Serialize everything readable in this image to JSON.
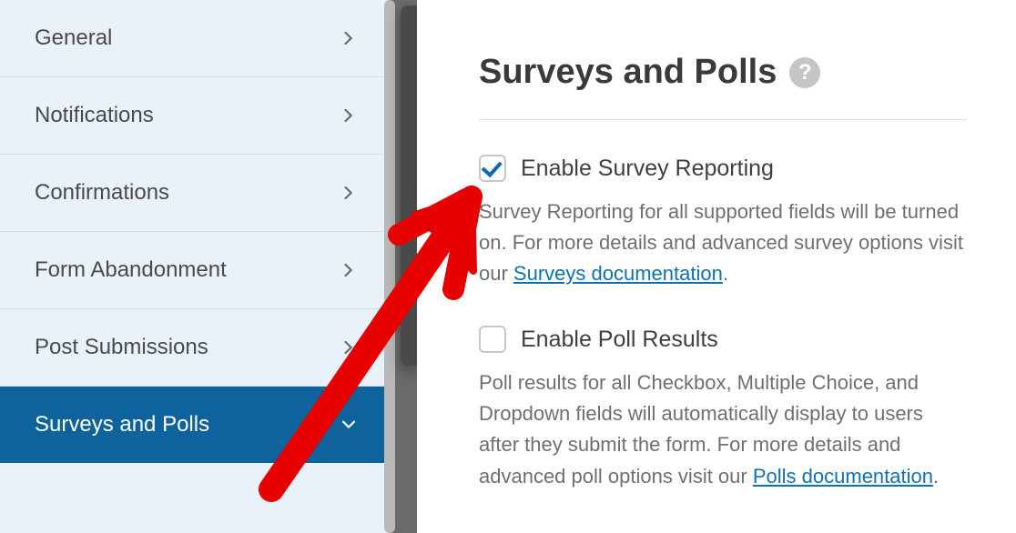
{
  "sidebar": {
    "items": [
      {
        "label": "General"
      },
      {
        "label": "Notifications"
      },
      {
        "label": "Confirmations"
      },
      {
        "label": "Form Abandonment"
      },
      {
        "label": "Post Submissions"
      },
      {
        "label": "Surveys and Polls"
      }
    ]
  },
  "panel": {
    "title": "Surveys and Polls",
    "help_glyph": "?",
    "options": [
      {
        "checked": true,
        "label": "Enable Survey Reporting",
        "desc_before": "Survey Reporting for all supported fields will be turned on. For more details and advanced survey options visit our ",
        "link_text": "Surveys documentation",
        "desc_after": "."
      },
      {
        "checked": false,
        "label": "Enable Poll Results",
        "desc_before": "Poll results for all Checkbox, Multiple Choice, and Dropdown fields will automatically display to users after they submit the form. For more details and advanced poll options visit our ",
        "link_text": "Polls documentation",
        "desc_after": "."
      }
    ]
  }
}
